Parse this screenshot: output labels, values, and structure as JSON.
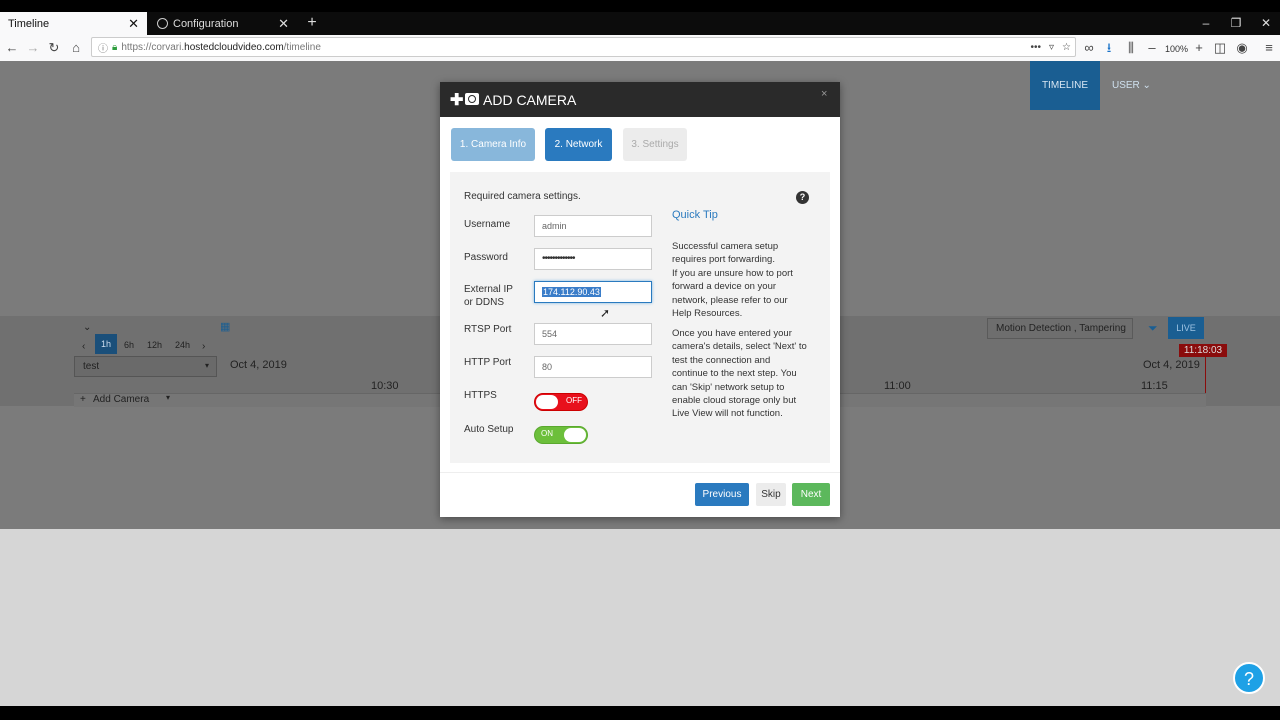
{
  "browser": {
    "tabs": [
      {
        "label": "Timeline",
        "close": "✕"
      },
      {
        "label": "Configuration",
        "close": "✕"
      }
    ],
    "url_prefix": "https://corvari.",
    "url_domain": "hostedcloudvideo.com",
    "url_path": "/timeline",
    "zoom": "100%"
  },
  "app": {
    "nav_timeline": "TIMELINE",
    "nav_user": "USER ⌄",
    "timeline": {
      "ranges": [
        "1h",
        "6h",
        "12h",
        "24h"
      ],
      "camera_select": "test",
      "date_left": "Oct 4, 2019",
      "date_right": "Oct 4, 2019",
      "time_ticks": [
        "10:30",
        "11:00",
        "11:15"
      ],
      "current_time": "11:18:03",
      "filter_select": "Motion Detection , Tampering",
      "live_label": "LIVE",
      "add_camera": "Add Camera"
    },
    "help_button": "?"
  },
  "modal": {
    "title": "ADD CAMERA",
    "close": "×",
    "steps": [
      "1. Camera Info",
      "2. Network",
      "3. Settings"
    ],
    "active_step": 2,
    "intro": "Required camera settings.",
    "fields": {
      "username_label": "Username",
      "username_value": "admin",
      "password_label": "Password",
      "password_value": "•••••••••••••",
      "external_ip_label_1": "External IP",
      "external_ip_label_2": "or DDNS",
      "external_ip_value": "174.112.90.43",
      "rtsp_label": "RTSP Port",
      "rtsp_value": "554",
      "http_label": "HTTP Port",
      "http_value": "80",
      "https_label": "HTTPS",
      "https_toggle": "OFF",
      "auto_setup_label": "Auto Setup",
      "auto_setup_toggle": "ON"
    },
    "quick_tip": {
      "title": "Quick Tip",
      "para1": [
        "Successful camera setup",
        "requires port forwarding.",
        "If you are unsure how to port",
        "forward a device on your",
        "network, please refer to our",
        "Help Resources."
      ],
      "para2": [
        "Once you have entered your",
        "camera's details, select 'Next' to",
        "test the connection and",
        "continue to the next step. You",
        "can 'Skip' network setup to",
        "enable cloud storage only but",
        "Live View will not function."
      ]
    },
    "buttons": {
      "previous": "Previous",
      "skip": "Skip",
      "next": "Next"
    }
  },
  "colors": {
    "primary": "#2a7abf",
    "success": "#5cb85c",
    "danger": "#e8101c",
    "header": "#2a2a2a"
  }
}
